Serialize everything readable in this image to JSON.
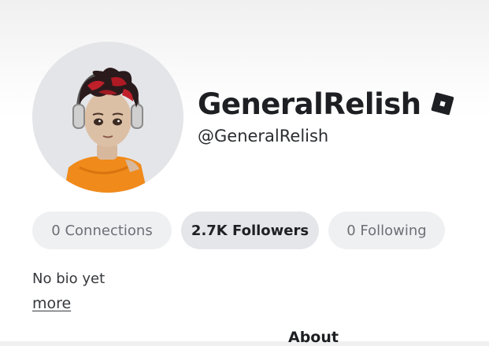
{
  "profile": {
    "display_name": "GeneralRelish",
    "username": "@GeneralRelish",
    "avatar_icon": "avatar-headshot",
    "badge_icon": "roblox-logo-icon"
  },
  "stats": {
    "connections": "0 Connections",
    "followers": "2.7K Followers",
    "following": "0 Following"
  },
  "bio": {
    "text": "No bio yet",
    "more_label": "more"
  },
  "tabs": {
    "about": "About"
  },
  "colors": {
    "pill_bg": "#eef0f2",
    "pill_active_bg": "#e4e6ea",
    "text_primary": "#1d1f23",
    "text_muted": "#6c6f75"
  }
}
